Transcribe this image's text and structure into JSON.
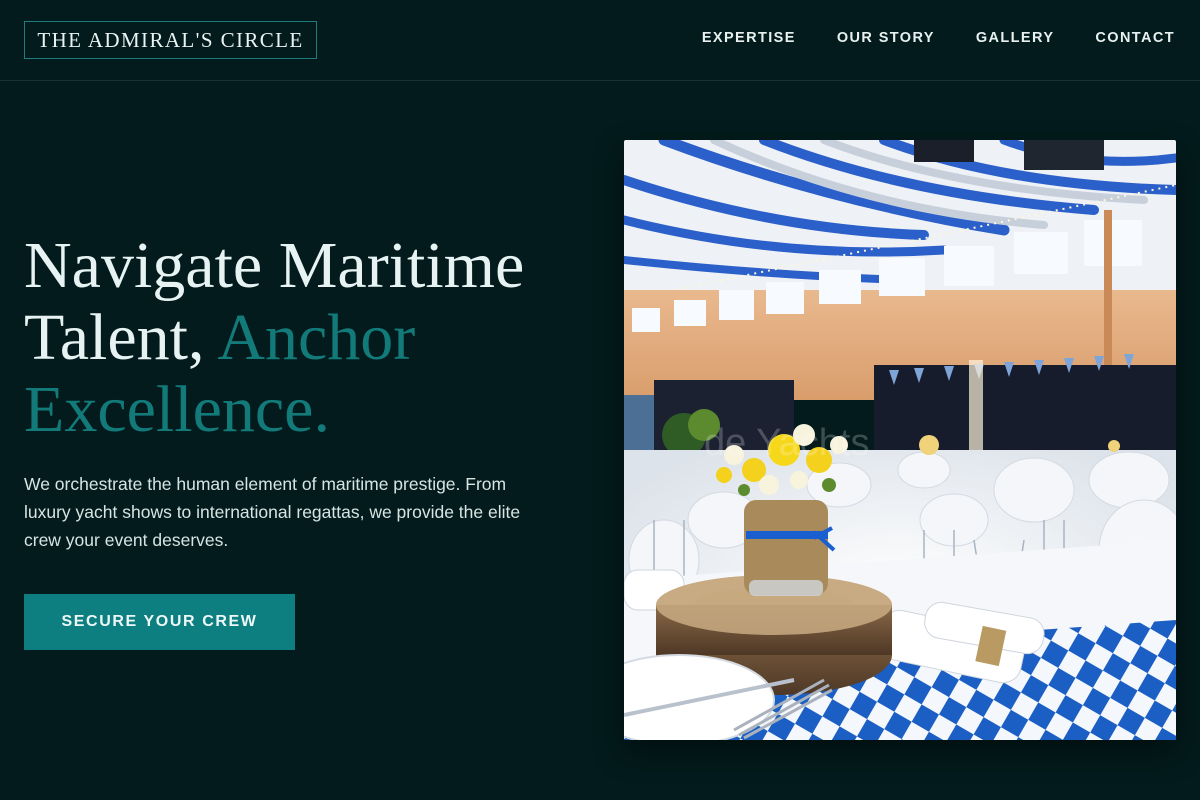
{
  "header": {
    "logo_text": "THE ADMIRAL'S CIRCLE",
    "nav": [
      {
        "label": "EXPERTISE"
      },
      {
        "label": "OUR STORY"
      },
      {
        "label": "GALLERY"
      },
      {
        "label": "CONTACT"
      }
    ]
  },
  "hero": {
    "title_line1": "Navigate Maritime",
    "title_line2_plain": "Talent, ",
    "title_line2_accent": "Anchor",
    "title_line3_accent": "Excellence.",
    "description": "We orchestrate the human element of maritime prestige. From luxury yacht shows to international regattas, we provide the elite crew your event deserves.",
    "cta_label": "SECURE YOUR CREW"
  },
  "photo": {
    "alt": "Banquet hall with round tables, blue and white checkered tablecloths, a burlap-wrapped jar of yellow and white flowers on a wooden log slice, and blue-white draped ceiling",
    "watermark": "de Yachts"
  },
  "colors": {
    "background": "#031b1c",
    "accent": "#137a7a",
    "button": "#0e7f80",
    "text": "#e6f3f2"
  }
}
